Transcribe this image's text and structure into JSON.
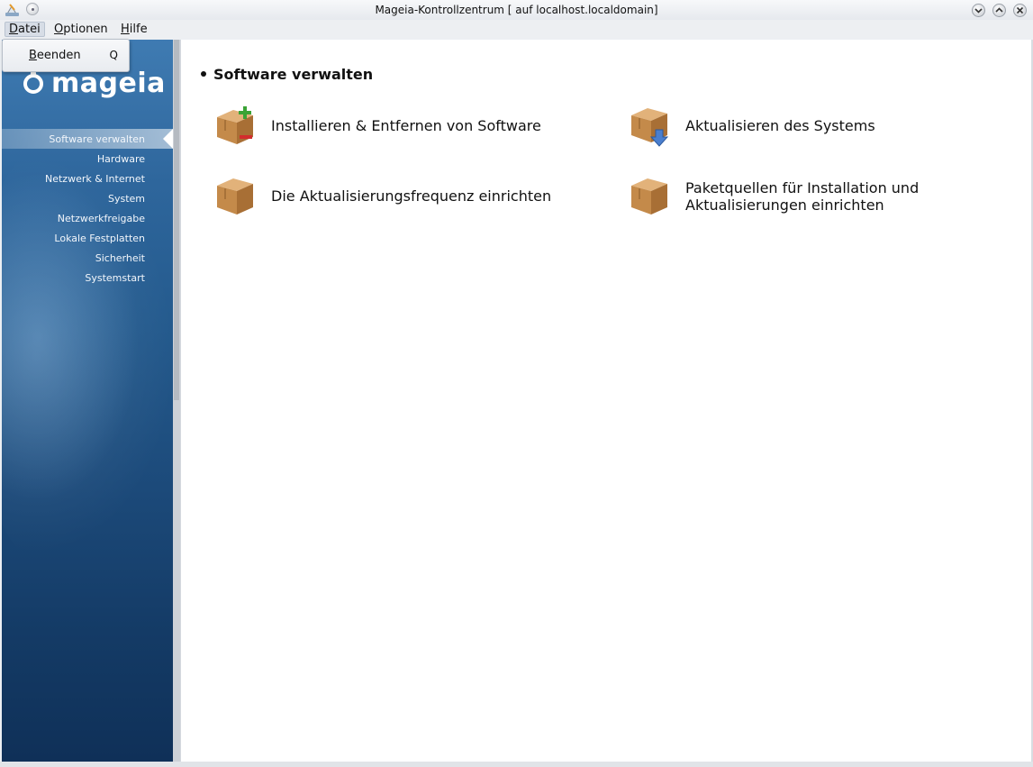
{
  "window": {
    "title": "Mageia-Kontrollzentrum  [ auf localhost.localdomain]"
  },
  "menubar": {
    "file": {
      "mnemonic": "D",
      "rest": "atei"
    },
    "options": {
      "mnemonic": "O",
      "rest": "ptionen"
    },
    "help": {
      "mnemonic": "H",
      "rest": "ilfe"
    }
  },
  "file_menu": {
    "items": [
      {
        "mnemonic": "B",
        "rest": "eenden",
        "accelerator": "Q"
      }
    ]
  },
  "sidebar": {
    "logo_text": "mageia",
    "selected_index": 0,
    "items": [
      {
        "label": "Software verwalten"
      },
      {
        "label": "Hardware"
      },
      {
        "label": "Netzwerk & Internet"
      },
      {
        "label": "System"
      },
      {
        "label": "Netzwerkfreigabe"
      },
      {
        "label": "Lokale Festplatten"
      },
      {
        "label": "Sicherheit"
      },
      {
        "label": "Systemstart"
      }
    ]
  },
  "main": {
    "section_title": "Software verwalten",
    "entries": [
      {
        "label_line1": "Installieren & Entfernen von Software",
        "label_line2": "",
        "icon": "package-add-remove-icon"
      },
      {
        "label_line1": "Aktualisieren des Systems",
        "label_line2": "",
        "icon": "package-update-icon"
      },
      {
        "label_line1": "Die Aktualisierungsfrequenz einrichten",
        "label_line2": "",
        "icon": "package-icon"
      },
      {
        "label_line1": "Paketquellen für Installation und",
        "label_line2": "Aktualisierungen einrichten",
        "icon": "package-icon"
      }
    ]
  },
  "colors": {
    "sidebar_top": "#3f7bb2",
    "sidebar_bottom": "#0f3058",
    "package_brown": "#c48a4a"
  }
}
